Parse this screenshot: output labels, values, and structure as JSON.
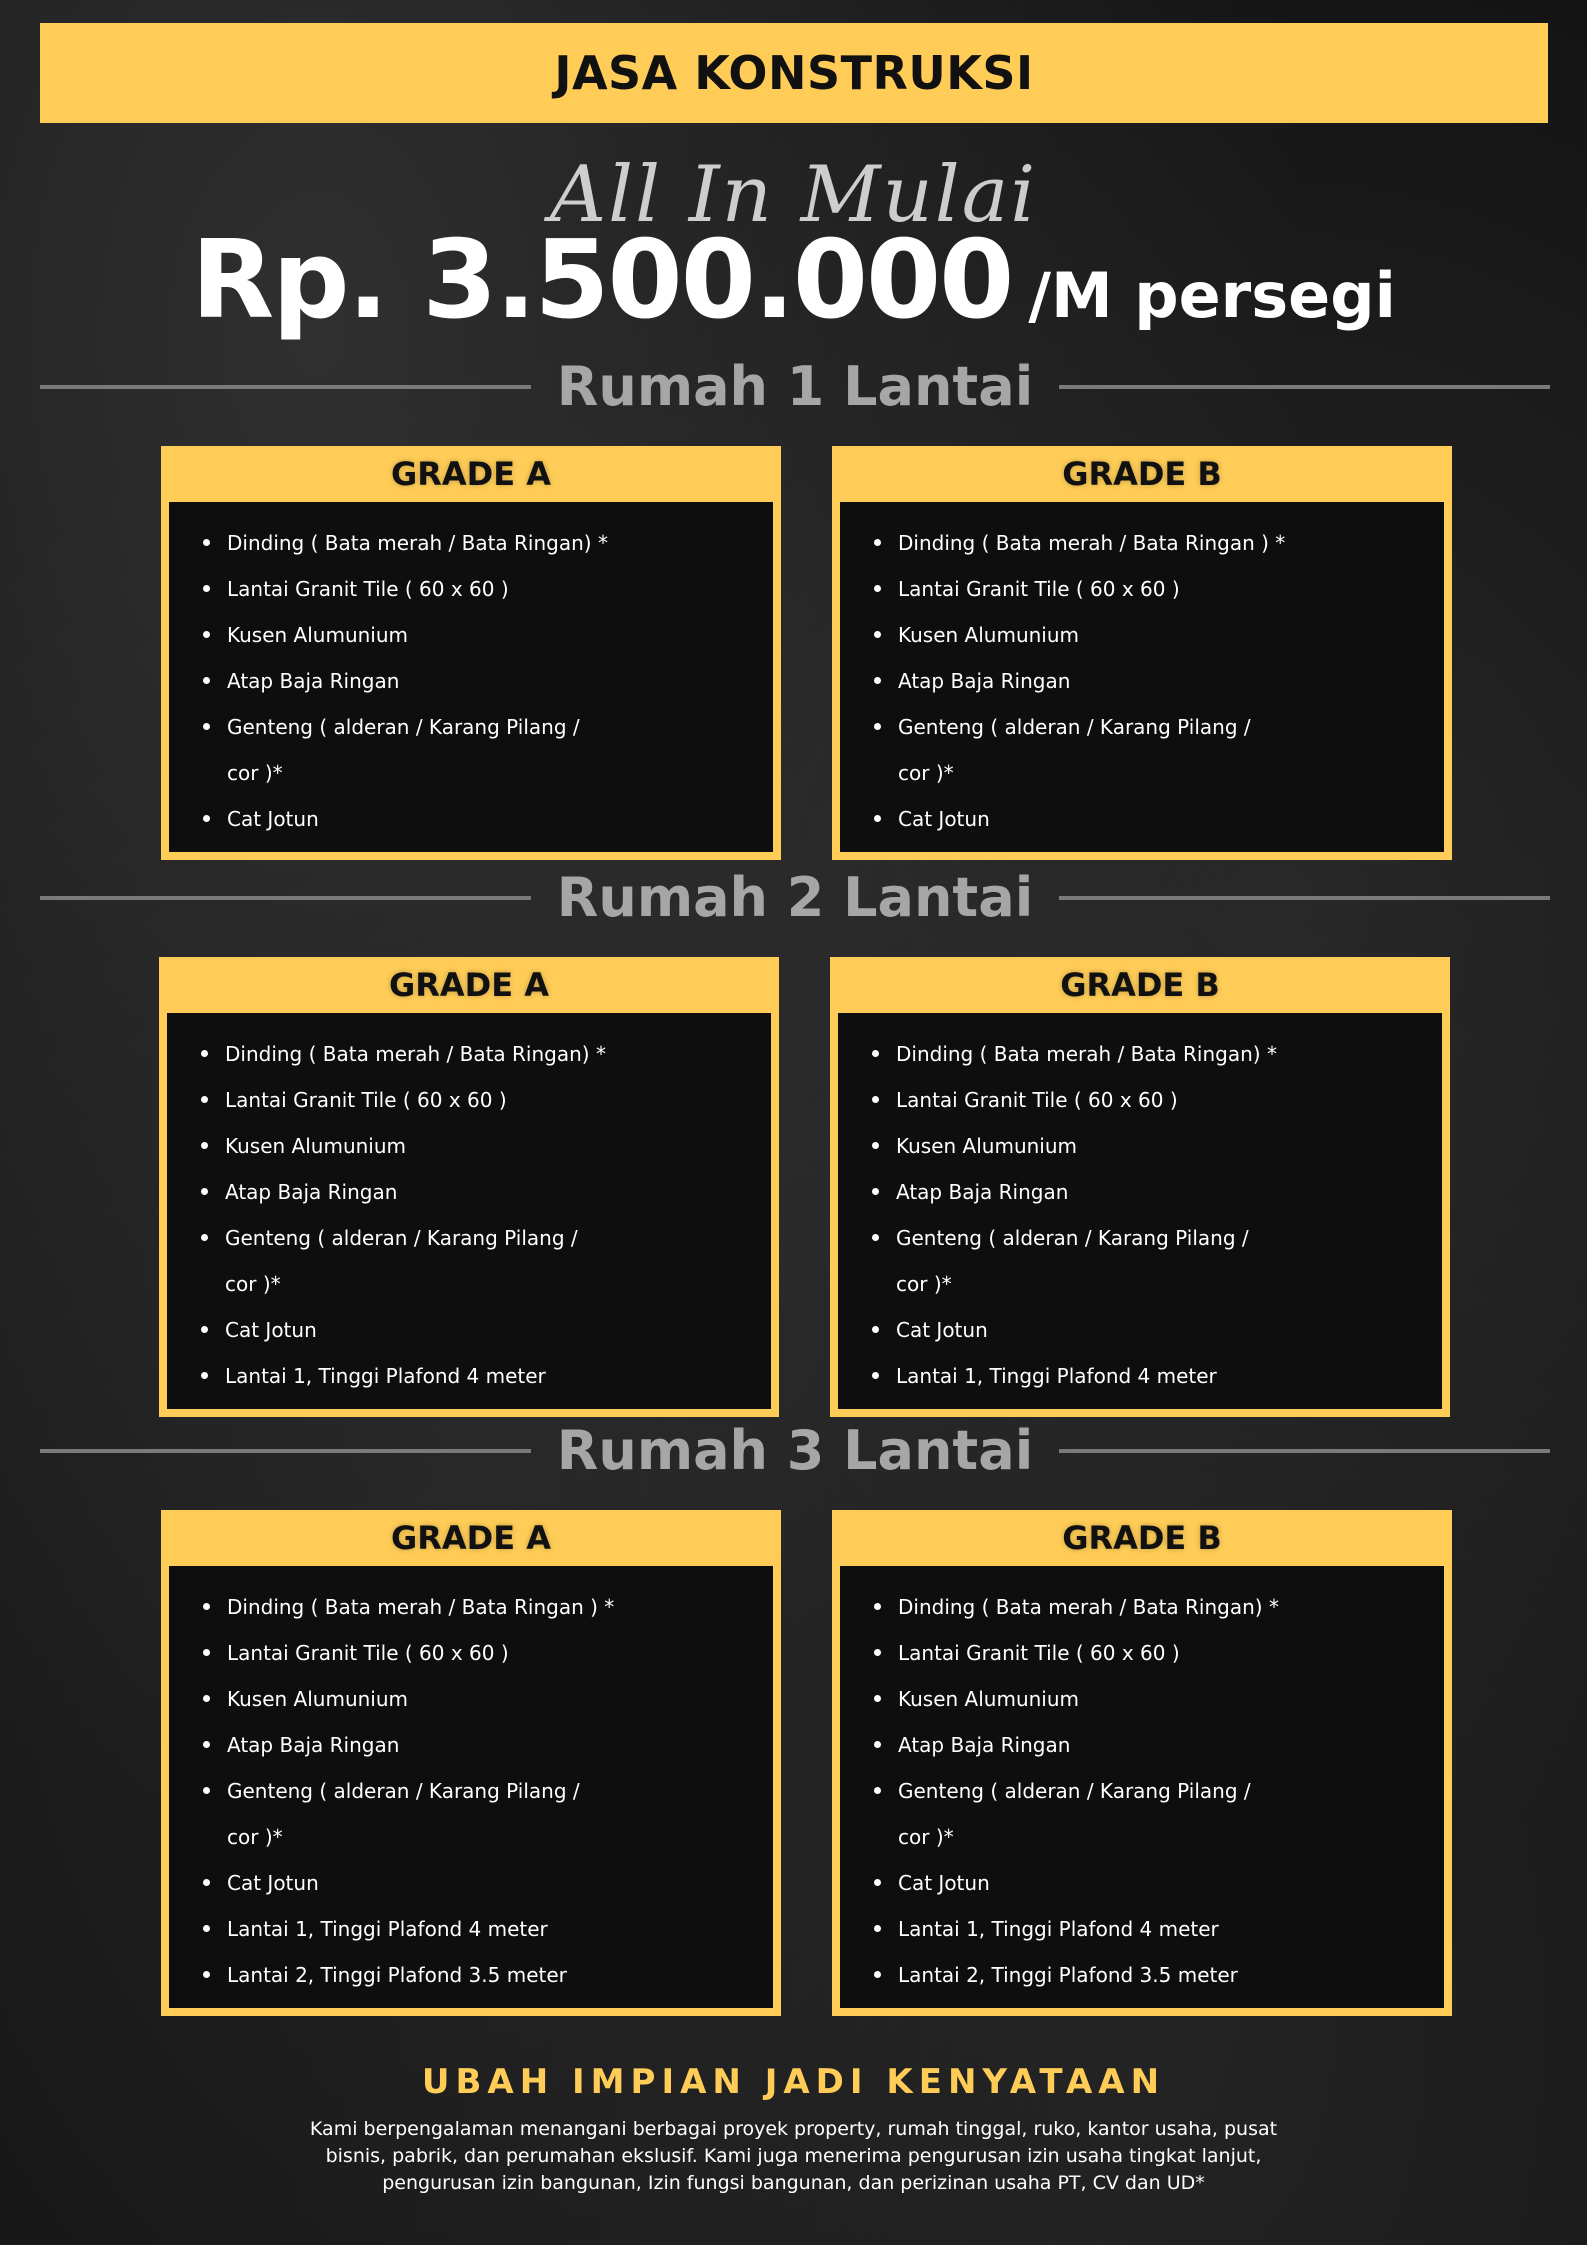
{
  "header": {
    "title": "JASA KONSTRUKSI"
  },
  "hero": {
    "tagline": "All In Mulai",
    "price": "Rp. 3.500.000",
    "unit": "/M persegi"
  },
  "sections": [
    {
      "title": "Rumah 1 Lantai",
      "cards": [
        {
          "grade": "GRADE A",
          "items": [
            "Dinding ( Bata merah / Bata Ringan) *",
            "Lantai Granit Tile ( 60 x 60 )",
            "Kusen Alumunium",
            "Atap Baja Ringan",
            "Genteng ( alderan / Karang Pilang /",
            "cor )*",
            "Cat Jotun"
          ]
        },
        {
          "grade": "GRADE B",
          "items": [
            "Dinding ( Bata merah / Bata Ringan ) *",
            "Lantai Granit Tile ( 60 x 60 )",
            "Kusen Alumunium",
            "Atap Baja Ringan",
            "Genteng ( alderan / Karang Pilang /",
            "cor )*",
            "Cat Jotun"
          ]
        }
      ]
    },
    {
      "title": "Rumah 2 Lantai",
      "cards": [
        {
          "grade": "GRADE A",
          "items": [
            "Dinding ( Bata merah / Bata Ringan) *",
            "Lantai Granit Tile ( 60 x 60 )",
            "Kusen Alumunium",
            "Atap Baja Ringan",
            "Genteng ( alderan / Karang Pilang /",
            "cor )*",
            "Cat Jotun",
            "Lantai 1, Tinggi Plafond 4 meter"
          ]
        },
        {
          "grade": "GRADE B",
          "items": [
            "Dinding ( Bata merah / Bata Ringan) *",
            "Lantai Granit Tile ( 60 x 60 )",
            "Kusen Alumunium",
            "Atap Baja Ringan",
            "Genteng ( alderan / Karang Pilang /",
            "cor )*",
            "Cat Jotun",
            "Lantai 1, Tinggi Plafond 4 meter"
          ]
        }
      ]
    },
    {
      "title": "Rumah 3 Lantai",
      "cards": [
        {
          "grade": "GRADE A",
          "items": [
            "Dinding ( Bata merah / Bata  Ringan ) *",
            "Lantai Granit Tile ( 60 x 60 )",
            "Kusen Alumunium",
            "Atap Baja Ringan",
            "Genteng ( alderan / Karang Pilang /",
            "cor )*",
            "Cat Jotun",
            "Lantai 1, Tinggi Plafond 4 meter",
            "Lantai 2, Tinggi Plafond 3.5 meter"
          ]
        },
        {
          "grade": "GRADE B",
          "items": [
            "Dinding ( Bata merah / Bata Ringan) *",
            "Lantai Granit Tile ( 60 x 60 )",
            "Kusen Alumunium",
            "Atap Baja Ringan",
            "Genteng ( alderan / Karang Pilang /",
            "cor )*",
            "Cat Jotun",
            "Lantai 1, Tinggi Plafond 4 meter",
            "Lantai 2, Tinggi Plafond 3.5 meter"
          ]
        }
      ]
    }
  ],
  "footer": {
    "heading": "UBAH IMPIAN JADI KENYATAAN",
    "text": "Kami berpengalaman menangani berbagai proyek property, rumah tinggal, ruko, kantor usaha, pusat bisnis, pabrik, dan perumahan ekslusif. Kami juga menerima pengurusan izin usaha tingkat lanjut, pengurusan izin bangunan, Izin fungsi bangunan, dan perizinan usaha PT, CV dan UD*"
  },
  "colors": {
    "accent": "#ffcd57",
    "background": "#141414",
    "card_body": "#0e0e0e",
    "section_title": "#a6a6a6"
  }
}
